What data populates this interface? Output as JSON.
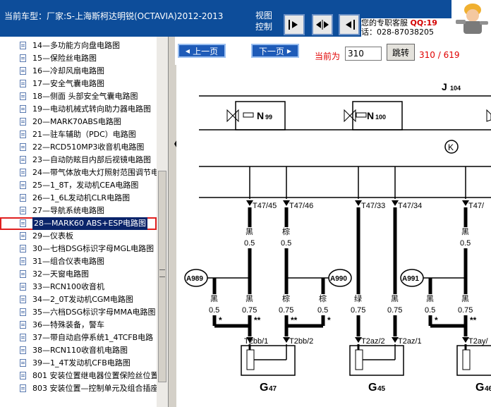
{
  "header": {
    "car_model": "当前车型：厂家:S-上海斯柯达明锐(OCTAVIA)2012-2013",
    "view_control": "视图控制",
    "service": "您的专职客服 ",
    "service_qq": "QQ:19",
    "service_tel": "话：028-87038205"
  },
  "sidebar": {
    "items": [
      {
        "label": "14—多功能方向盘电路图"
      },
      {
        "label": "15—保险丝电路图"
      },
      {
        "label": "16—冷却风扇电路图"
      },
      {
        "label": "17—安全气囊电路图"
      },
      {
        "label": "18—侧面 头部安全气囊电路图"
      },
      {
        "label": "19—电动机械式转向助力器电路图"
      },
      {
        "label": "20—MARK70ABS电路图"
      },
      {
        "label": "21—驻车辅助（PDC）电路图"
      },
      {
        "label": "22—RCD510MP3收音机电路图"
      },
      {
        "label": "23—自动防眩目内部后视镜电路图"
      },
      {
        "label": "24—带气体放电大灯照射范围调节电"
      },
      {
        "label": "25—1_8T，发动机CEA电路图"
      },
      {
        "label": "26—1_6L发动机CLR电路图"
      },
      {
        "label": "27—导航系统电路图"
      },
      {
        "label": "28—MARK60 ABS+ESP电路图",
        "selected": true
      },
      {
        "label": "29—仪表板"
      },
      {
        "label": "30—七档DSG标识字母MGL电路图"
      },
      {
        "label": "31—组合仪表电路图"
      },
      {
        "label": "32—天窗电路图"
      },
      {
        "label": "33—RCN100收音机"
      },
      {
        "label": "34—2_0T发动机CGM电路图"
      },
      {
        "label": "35—六档DSG标识字母MMA电路图"
      },
      {
        "label": "36—特殊装备，警车"
      },
      {
        "label": "37—带自动启停系统1_4TCFB电路"
      },
      {
        "label": "38—RCN110收音机电路图"
      },
      {
        "label": "39—1_4T发动机CFB电路图"
      },
      {
        "label": "801 安装位置继电器位置保险丝位置"
      },
      {
        "label": "803 安装位置—控制单元及组合插座"
      }
    ]
  },
  "toolbar": {
    "prev_label": "上一页",
    "next_label": "下一页",
    "current_label": "当前为",
    "page_value": "310",
    "jump_label": "跳转",
    "page_count": "310 / 619"
  },
  "diagram": {
    "j_label": "J",
    "j_sub": "104",
    "n99": "N",
    "n99_sub": "99",
    "n100": "N",
    "n100_sub": "100",
    "k_symbol": "K",
    "connectors": [
      "T47/45",
      "T47/46",
      "T47/33",
      "T47/34",
      "T47/"
    ],
    "wire_colors_upper": [
      "黑",
      "棕",
      "黑"
    ],
    "wire_sizes_upper": [
      "0.5",
      "0.5",
      "0.5"
    ],
    "grounds": [
      "A989",
      "A990",
      "A991"
    ],
    "wire_colors_lower": [
      "黑",
      "黑",
      "棕",
      "棕",
      "绿",
      "黑",
      "黑",
      "黑"
    ],
    "wire_sizes_lower": [
      "0.5",
      "0.75",
      "0.75",
      "0.5",
      "0.75",
      "0.75",
      "0.5",
      "0.75"
    ],
    "single_star": "*",
    "double_star": "**",
    "sensor_pins": [
      "T2bb/1",
      "T2bb/2",
      "T2az/2",
      "T2az/1",
      "T2ay/"
    ],
    "sensors": [
      {
        "name": "G",
        "sub": "47"
      },
      {
        "name": "G",
        "sub": "45"
      },
      {
        "name": "G",
        "sub": "46"
      }
    ]
  }
}
